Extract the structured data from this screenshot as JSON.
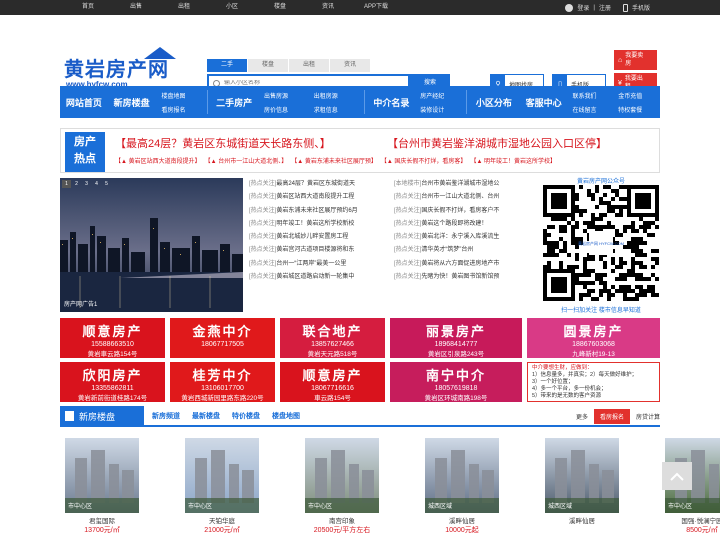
{
  "topbar": {
    "links": [
      "首页",
      "出售",
      "出租",
      "小区",
      "楼盘",
      "资讯",
      "APP下载"
    ],
    "login": "登录",
    "sep": "|",
    "register": "注册",
    "mobile": "手机版"
  },
  "logo": {
    "title": "黄岩房产网",
    "url": "www.hyfcw.com"
  },
  "search": {
    "tabs": [
      "二手",
      "楼盘",
      "出租",
      "资讯"
    ],
    "placeholder": "输入小区名称",
    "button": "搜索",
    "map_find": "地图找房",
    "mobile": "手机版",
    "sell_btn": "我要卖房",
    "rent_btn": "我要出租"
  },
  "nav": {
    "home": "网站首页",
    "new": "新房楼盘",
    "sub1": [
      "楼盘地图",
      "看房报名"
    ],
    "used": "二手房产",
    "sub2": [
      "出售房源",
      "房价信息"
    ],
    "sub3": [
      "出租房源",
      "求租信息"
    ],
    "agent": "中介名录",
    "sub4": [
      "房产经纪",
      "装修设计"
    ],
    "community": "小区分布",
    "service": "客服中心",
    "sub5": [
      "联系我们",
      "在线留言"
    ],
    "sub6": [
      "金币充值",
      "特权套餐"
    ]
  },
  "hot": {
    "label1": "房产",
    "label2": "热点",
    "h1": "【最高24层？黄岩区东城街道天长路东侧、】",
    "h2": "【台州市黄岩鉴洋湖城市湿地公园入口区停】",
    "links": [
      "【▲ 黄岩区站西大道南段提升】",
      "【▲ 台州市一江山大道北侧、】",
      "【▲ 黄岩东浦未来社区展厅预】",
      "【▲ 国庆长假不打烊，看房客】",
      "【▲ 明年竣工！黄岩这所学校】"
    ]
  },
  "banner": {
    "caption": "房产网广告1",
    "dots": [
      "1",
      "2",
      "3",
      "4",
      "5"
    ]
  },
  "news": {
    "left": [
      {
        "tag": "[热点关注]",
        "text": "最高24层？黄岩区东城街道天"
      },
      {
        "tag": "[热点关注]",
        "text": "黄岩区站西大道南段提升工程"
      },
      {
        "tag": "[热点关注]",
        "text": "黄岩东浦未来社区展厅预约6月"
      },
      {
        "tag": "[热点关注]",
        "text": "明年竣工！黄岩这所学校新校"
      },
      {
        "tag": "[热点关注]",
        "text": "黄岩北城妙儿畔安置房工程"
      },
      {
        "tag": "[热点关注]",
        "text": "黄岩宫河古道项目楼源将和东"
      },
      {
        "tag": "[热点关注]",
        "text": "台州一“江两岸”最美一公里"
      },
      {
        "tag": "[热点关注]",
        "text": "黄岩城区道路启动新一轮集中"
      }
    ],
    "right": [
      {
        "tag": "[本地楼市]",
        "text": "台州市黄岩鉴洋湖城市湿地公"
      },
      {
        "tag": "[热点关注]",
        "text": "台州市一江山大道北侧、台州"
      },
      {
        "tag": "[热点关注]",
        "text": "国庆长假不打烊，看房客户不"
      },
      {
        "tag": "[热点关注]",
        "text": "黄岩这个路段即将改建！"
      },
      {
        "tag": "[热点关注]",
        "text": "黄岩北洋：永宁溪入库溪流生"
      },
      {
        "tag": "[热点关注]",
        "text": "清华英才“筑梦”台州"
      },
      {
        "tag": "[热点关注]",
        "text": "黄岩将从六方面促进房地产市"
      },
      {
        "tag": "[热点关注]",
        "text": "先睹为快！黄岩图书馆新馆预"
      }
    ]
  },
  "qr": {
    "title": "黄岩房产网公众号",
    "footer": "扫一扫加关注  楼市信息早知道",
    "center": "黄岩房产网 HYFCW.COM"
  },
  "ads": [
    {
      "name": "顺意房产",
      "phone": "15588663510",
      "addr": "黄岩車云路154号"
    },
    {
      "name": "金燕中介",
      "phone": "18067717505",
      "addr": ""
    },
    {
      "name": "联合地产",
      "phone": "13857627466",
      "addr": "黄岩天元路518号"
    },
    {
      "name": "丽景房产",
      "phone": "18968414777",
      "addr": "黄岩区引泉路243号"
    },
    {
      "name": "圆景房产",
      "phone": "18867603068",
      "addr": "九峰新村19-13"
    },
    {
      "name": "欣阳房产",
      "phone": "13355862811",
      "addr": "黄岩新前街道桂路174号"
    },
    {
      "name": "桂芳中介",
      "phone": "13106017700",
      "addr": "黄岩西城新园里路东路220号"
    },
    {
      "name": "顺意房产",
      "phone": "18067716616",
      "addr": "車云路154号"
    },
    {
      "name": "南宁中介",
      "phone": "18057619818",
      "addr": "黄岩区环城南路198号"
    }
  ],
  "notice": {
    "title": "中介要想生财，应做到：",
    "lines": [
      "1）信息量多，并真实；2）每天做好维护；",
      "3）一个好位置；",
      "4）多一个平台，多一份机会；",
      "5）带来的是无数的客户资源"
    ]
  },
  "newhouse": {
    "title": "新房楼盘",
    "tabs": [
      "新房频道",
      "最新楼盘",
      "特价楼盘",
      "楼盘地图"
    ],
    "more": "更多",
    "signup": "看房报名",
    "calc": "房贷计算"
  },
  "cards": [
    {
      "name": "君玺国际",
      "price": "13700元/㎡",
      "tag": "市中心区",
      "color": "#6b7a8f"
    },
    {
      "name": "天铂华庭",
      "price": "21000元/㎡",
      "tag": "市中心区",
      "color": "#8ca6c8"
    },
    {
      "name": "南宫印象",
      "price": "20500元/平方左右",
      "tag": "市中心区",
      "color": "#7d8c7a"
    },
    {
      "name": "溪畔仙居",
      "price": "10000元起",
      "tag": "城西区域",
      "color": "#5f6e85"
    },
    {
      "name": "溪畔仙居",
      "price": "",
      "tag": "城西区域",
      "color": "#4c5a6b"
    },
    {
      "name": "国强·悦澜宁园",
      "price": "8500元/㎡",
      "tag": "市中心区",
      "color": "#4a6a3a"
    }
  ]
}
